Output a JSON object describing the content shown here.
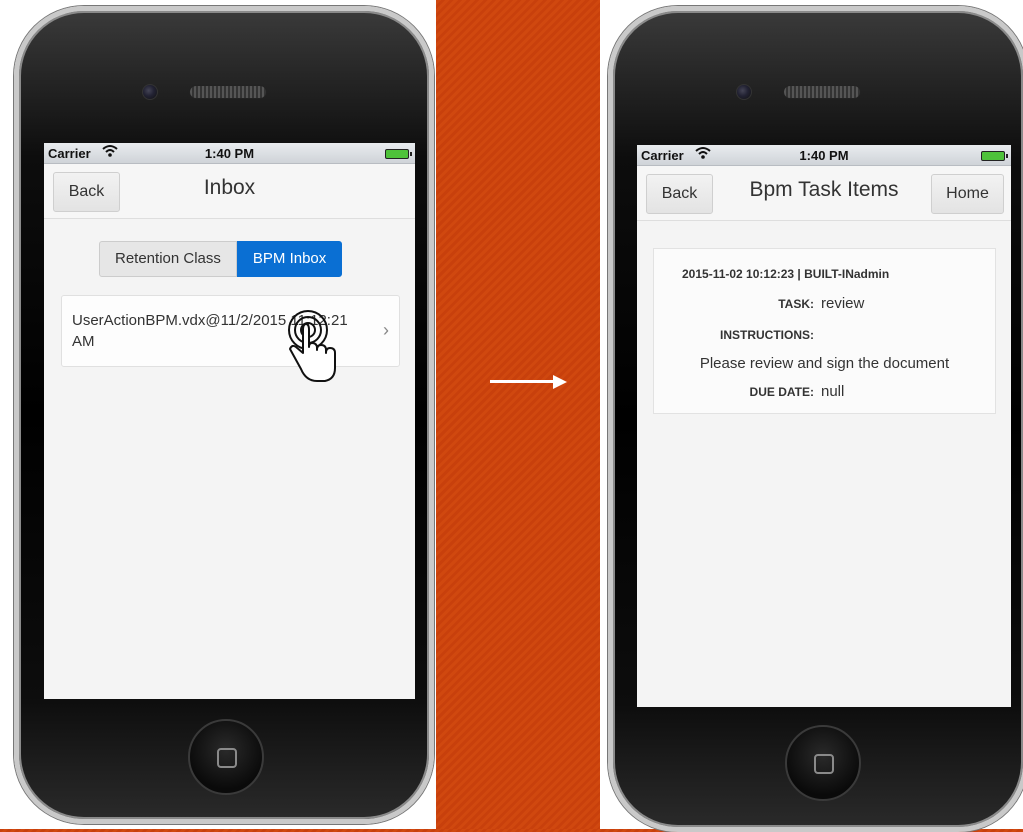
{
  "left": {
    "status": {
      "carrier": "Carrier",
      "time": "1:40 PM"
    },
    "nav": {
      "back": "Back",
      "title": "Inbox"
    },
    "segments": {
      "inactive": "Retention Class",
      "active": "BPM Inbox"
    },
    "item": {
      "line1": "UserActionBPM.vdx@11/2/2015 11:12:21",
      "line2": "AM",
      "chevron": "›"
    }
  },
  "right": {
    "status": {
      "carrier": "Carrier",
      "time": "1:40 PM"
    },
    "nav": {
      "back": "Back",
      "title": "Bpm Task Items",
      "home": "Home"
    },
    "task": {
      "header": "2015-11-02 10:12:23 | BUILT-INadmin",
      "task_label": "TASK:",
      "task_value": "review",
      "instructions_label": "INSTRUCTIONS:",
      "instructions_value": "Please review and sign the document",
      "due_label": "DUE DATE:",
      "due_value": "null"
    }
  },
  "icons": {
    "wifi": "wifi-icon",
    "battery": "battery-icon",
    "chevron": "chevron-right-icon",
    "hand": "tap-hand-icon",
    "arrow": "arrow-right-icon"
  },
  "colors": {
    "background": "#c8400c",
    "accent": "#0a6fd3",
    "battery": "#4ec23a"
  }
}
